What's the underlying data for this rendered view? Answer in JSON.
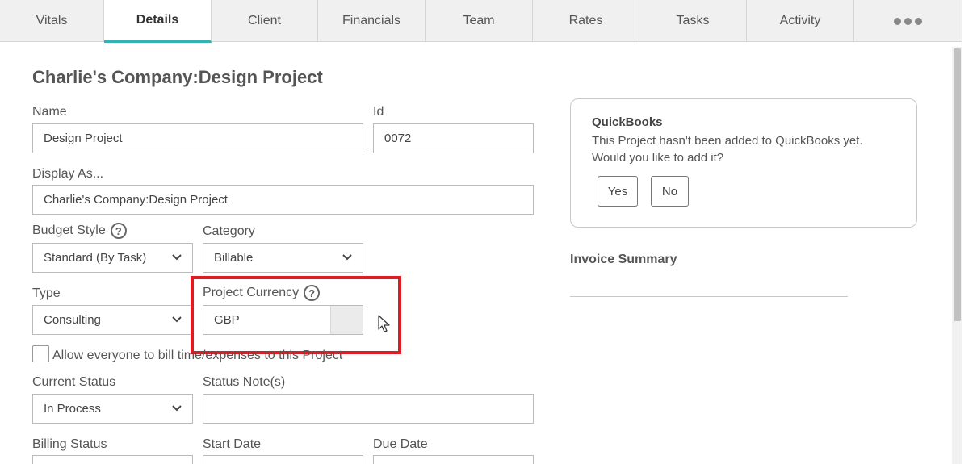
{
  "tabs": [
    {
      "label": "Vitals"
    },
    {
      "label": "Details"
    },
    {
      "label": "Client"
    },
    {
      "label": "Financials"
    },
    {
      "label": "Team"
    },
    {
      "label": "Rates"
    },
    {
      "label": "Tasks"
    },
    {
      "label": "Activity"
    }
  ],
  "page_title": "Charlie's Company:Design Project",
  "form": {
    "name_label": "Name",
    "name_value": "Design Project",
    "id_label": "Id",
    "id_value": "0072",
    "display_as_label": "Display As...",
    "display_as_value": "Charlie's Company:Design Project",
    "budget_style_label": "Budget Style",
    "budget_style_value": "Standard (By Task)",
    "category_label": "Category",
    "category_value": "Billable",
    "type_label": "Type",
    "type_value": "Consulting",
    "project_currency_label": "Project Currency",
    "project_currency_value": "GBP",
    "allow_bill_label": "Allow everyone to bill time/expenses to this Project",
    "current_status_label": "Current Status",
    "current_status_value": "In Process",
    "status_notes_label": "Status Note(s)",
    "status_notes_value": "",
    "billing_status_label": "Billing Status",
    "start_date_label": "Start Date",
    "due_date_label": "Due Date"
  },
  "quickbooks": {
    "title": "QuickBooks",
    "message": "This Project hasn't been added to QuickBooks yet. Would you like to add it?",
    "yes_label": "Yes",
    "no_label": "No"
  },
  "invoice_summary": {
    "title": "Invoice Summary"
  },
  "colors": {
    "accent": "#35b3b3",
    "highlight": "#e11b22"
  }
}
